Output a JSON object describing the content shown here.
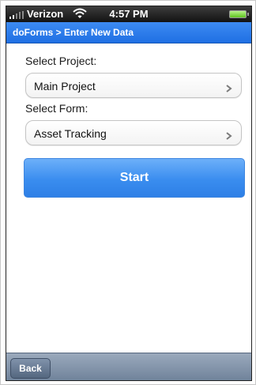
{
  "status_bar": {
    "carrier": "Verizon",
    "time": "4:57 PM",
    "signal_icon": "signal-bars-icon",
    "wifi_icon": "wifi-icon",
    "battery_icon": "battery-icon"
  },
  "nav": {
    "title": "doForms > Enter New Data"
  },
  "project": {
    "label": "Select Project:",
    "value": "Main Project",
    "chevron_icon": "chevron-right-icon"
  },
  "form": {
    "label": "Select Form:",
    "value": "Asset Tracking",
    "chevron_icon": "chevron-right-icon"
  },
  "actions": {
    "start_label": "Start"
  },
  "toolbar": {
    "back_label": "Back"
  },
  "colors": {
    "nav_blue": "#1f6fe3",
    "start_blue": "#3a8def",
    "toolbar_gray": "#6e8199"
  }
}
